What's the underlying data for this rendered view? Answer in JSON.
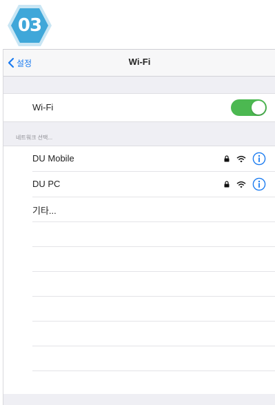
{
  "step_badge": {
    "number": "03",
    "color": "#3fa7d9"
  },
  "navbar": {
    "back_label": "설정",
    "title": "Wi-Fi"
  },
  "wifi_toggle": {
    "label": "Wi-Fi",
    "state": "on",
    "on_color": "#4cb851"
  },
  "section_header": "네트워크 선택...",
  "networks": [
    {
      "name": "DU Mobile",
      "locked": true,
      "icons": [
        "lock-icon",
        "wifi-icon",
        "info-icon"
      ]
    },
    {
      "name": "DU PC",
      "locked": true,
      "icons": [
        "lock-icon",
        "wifi-icon",
        "info-icon"
      ]
    },
    {
      "name": "기타..."
    }
  ],
  "accent_color": "#1a7bf0"
}
